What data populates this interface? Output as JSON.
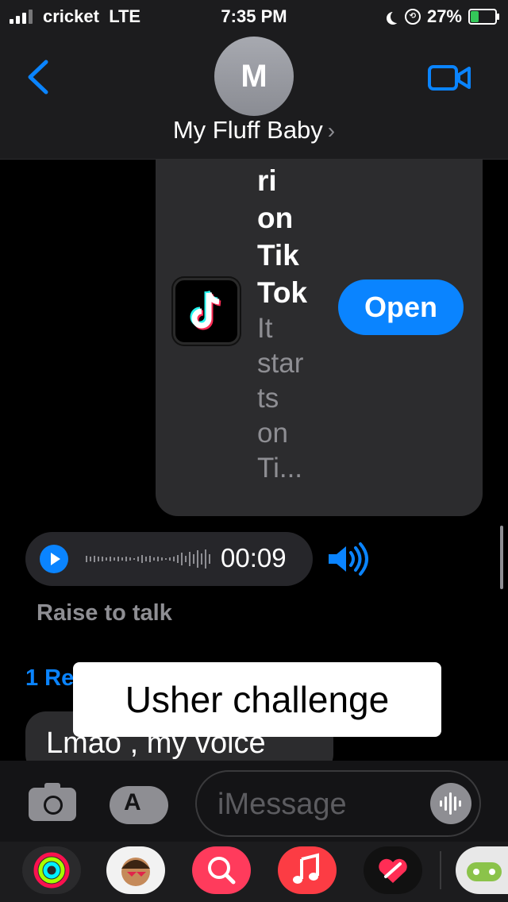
{
  "status_bar": {
    "carrier": "cricket",
    "network": "LTE",
    "time": "7:35 PM",
    "battery": "27%",
    "icons": [
      "signal-icon",
      "moon-icon",
      "orientation-lock-icon",
      "battery-icon"
    ]
  },
  "header": {
    "avatar_initial": "M",
    "contact_name": "My Fluff Baby",
    "chevron": "›",
    "back_icon": "chevron-left-icon",
    "video_icon": "video-camera-icon"
  },
  "link_preview": {
    "title_lines": [
      "ri",
      "on",
      "Tik",
      "Tok"
    ],
    "subtitle_lines": [
      "It",
      "star",
      "ts",
      "on",
      "Ti..."
    ],
    "button_label": "Open",
    "app_icon": "tiktok-icon"
  },
  "voice_message": {
    "duration": "00:09",
    "hint": "Raise to talk"
  },
  "receipt": {
    "label": "1 Re"
  },
  "incoming_message": {
    "text": "Lmao , my voice"
  },
  "caption_overlay": {
    "text": "Usher challenge"
  },
  "input_bar": {
    "placeholder": "iMessage",
    "camera_icon": "camera-icon",
    "appstore_icon": "app-store-icon",
    "mic_icon": "audio-waveform-icon"
  },
  "app_drawer": {
    "apps": [
      {
        "name": "activity-app-icon",
        "color": "#1c1c1e"
      },
      {
        "name": "memoji-app-icon",
        "color": "#f2f2f2"
      },
      {
        "name": "images-search-app-icon",
        "color": "#ff3b5c"
      },
      {
        "name": "music-app-icon",
        "color": "#fc3c44"
      },
      {
        "name": "digital-touch-app-icon",
        "color": "#111111"
      },
      {
        "name": "games-app-icon",
        "color": "#e8e8e8"
      }
    ]
  },
  "colors": {
    "accent": "#0a84ff",
    "bubble": "#2c2c2e",
    "background": "#000000"
  }
}
